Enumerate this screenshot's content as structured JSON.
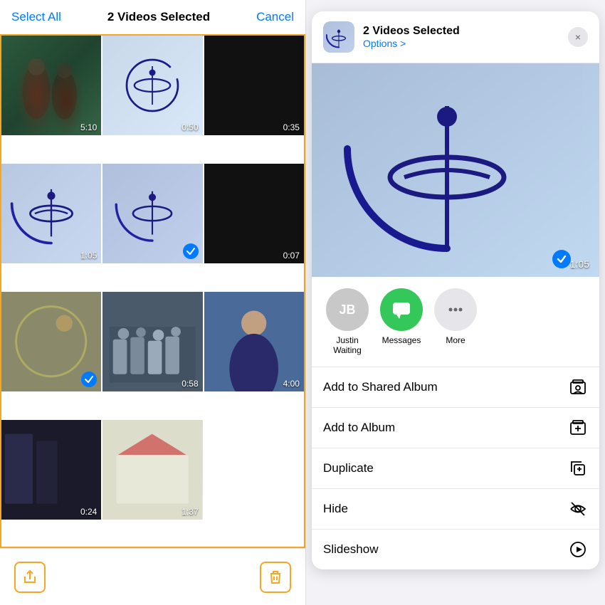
{
  "leftPanel": {
    "selectAll": "Select All",
    "selectedCount": "2 Videos Selected",
    "cancel": "Cancel"
  },
  "gridCells": [
    {
      "id": 1,
      "duration": "5:10",
      "selected": false,
      "type": "people"
    },
    {
      "id": 2,
      "duration": "0:50",
      "selected": false,
      "type": "logo"
    },
    {
      "id": 3,
      "duration": "0:35",
      "selected": false,
      "type": "dark"
    },
    {
      "id": 4,
      "duration": "1:05",
      "selected": false,
      "type": "logo-large"
    },
    {
      "id": 5,
      "duration": null,
      "selected": true,
      "type": "logo-small"
    },
    {
      "id": 6,
      "duration": "0:07",
      "selected": false,
      "type": "dark"
    },
    {
      "id": 7,
      "duration": null,
      "selected": true,
      "type": "circle"
    },
    {
      "id": 8,
      "duration": "0:58",
      "selected": false,
      "type": "crowd"
    },
    {
      "id": 9,
      "duration": "4:00",
      "selected": false,
      "type": "presenter"
    },
    {
      "id": 10,
      "duration": "0:24",
      "selected": false,
      "type": "dark-blue"
    },
    {
      "id": 11,
      "duration": "1:37",
      "selected": false,
      "type": "light"
    }
  ],
  "shareSheet": {
    "title": "2 Videos Selected",
    "subtitle": "Options >",
    "closeBtn": "×",
    "previewDuration": "1:05",
    "actions": [
      {
        "label": "Justin\nWaiting",
        "type": "person",
        "initials": "JB"
      },
      {
        "label": "Messages",
        "type": "messages"
      },
      {
        "label": "More",
        "type": "more"
      }
    ],
    "menuItems": [
      {
        "label": "Add to Shared Album",
        "icon": "shared-album-icon"
      },
      {
        "label": "Add to Album",
        "icon": "add-album-icon"
      },
      {
        "label": "Duplicate",
        "icon": "duplicate-icon"
      },
      {
        "label": "Hide",
        "icon": "hide-icon"
      },
      {
        "label": "Slideshow",
        "icon": "slideshow-icon"
      }
    ]
  }
}
